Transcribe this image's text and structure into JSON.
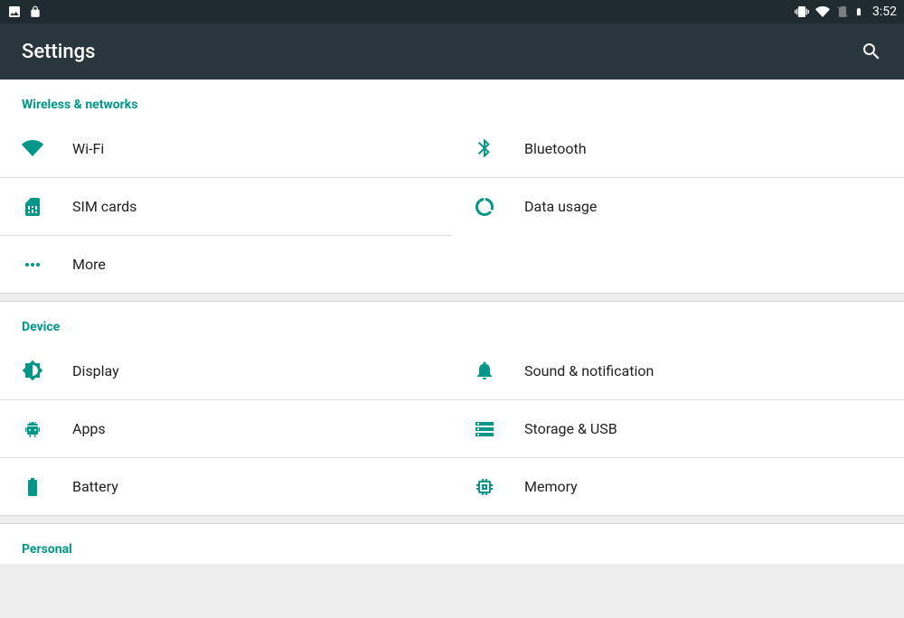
{
  "status": {
    "time": "3:52"
  },
  "app": {
    "title": "Settings"
  },
  "sections": {
    "wireless": {
      "header": "Wireless & networks",
      "wifi": "Wi-Fi",
      "bluetooth": "Bluetooth",
      "sim": "SIM cards",
      "data": "Data usage",
      "more": "More"
    },
    "device": {
      "header": "Device",
      "display": "Display",
      "sound": "Sound & notification",
      "apps": "Apps",
      "storage": "Storage & USB",
      "battery": "Battery",
      "memory": "Memory"
    },
    "personal": {
      "header": "Personal"
    }
  }
}
